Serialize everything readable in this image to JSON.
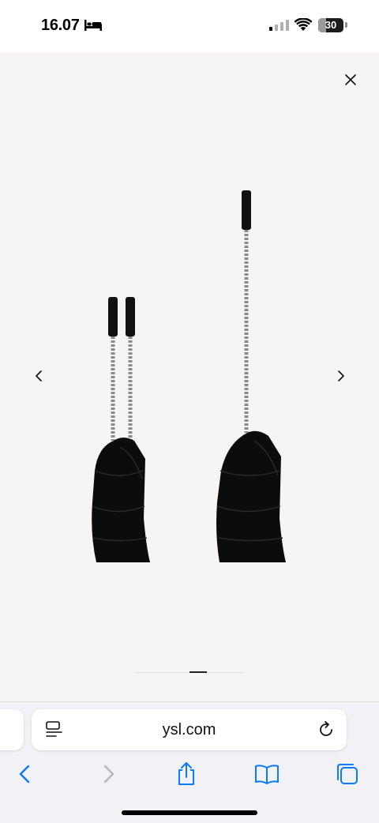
{
  "status_bar": {
    "time": "16.07",
    "battery": "30",
    "battery_level": 0.3,
    "icons": [
      "bed-icon",
      "cellular-signal-icon",
      "wifi-icon",
      "battery-icon"
    ]
  },
  "viewer": {
    "background": "#f6f5f3",
    "icons": [
      "close-icon",
      "chevron-left-icon",
      "chevron-right-icon"
    ],
    "image": "black quilted chain shoulder bag, two views",
    "pager": {
      "current": 2,
      "total": 3
    }
  },
  "browser": {
    "url": "ysl.com",
    "accent_color": "#0a7aff",
    "icons": [
      "reader-icon",
      "reload-icon",
      "back-icon",
      "forward-icon",
      "share-icon",
      "bookmarks-icon",
      "tabs-icon"
    ]
  }
}
